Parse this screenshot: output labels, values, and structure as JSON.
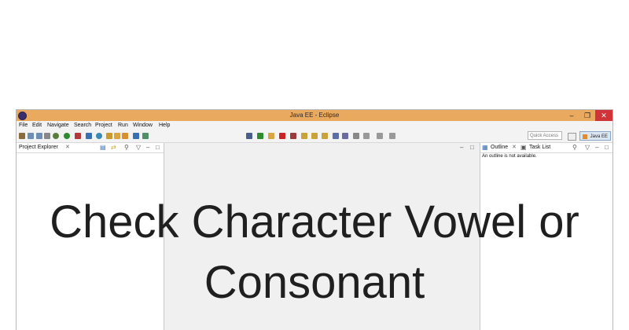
{
  "window": {
    "title": "Java EE - Eclipse",
    "min_glyph": "–",
    "max_glyph": "❐",
    "close_glyph": "✕"
  },
  "menu": [
    "File",
    "Edit",
    "Navigate",
    "Search",
    "Project",
    "Run",
    "Window",
    "Help"
  ],
  "toolbar": {
    "quick_access_placeholder": "Quick Access",
    "perspective_label": "Java EE",
    "icons": [
      {
        "name": "new-icon",
        "color": "#8a6d3b"
      },
      {
        "name": "save-icon",
        "color": "#6d8fb3"
      },
      {
        "name": "save-all-icon",
        "color": "#6d8fb3"
      },
      {
        "name": "print-icon",
        "color": "#888888"
      },
      {
        "name": "debug-icon",
        "color": "#5a7d3a"
      },
      {
        "name": "run-icon",
        "color": "#2e8b2e"
      },
      {
        "name": "external-tools-icon",
        "color": "#b33a3a"
      },
      {
        "name": "new-server-icon",
        "color": "#3a6fb3"
      },
      {
        "name": "globe-icon",
        "color": "#3a8bb3"
      },
      {
        "name": "open-type-icon",
        "color": "#c99a2e"
      },
      {
        "name": "open-folder-icon",
        "color": "#d9a441"
      },
      {
        "name": "search-tool-icon",
        "color": "#d98f2e"
      },
      {
        "name": "web-browser-icon",
        "color": "#3a6fb3"
      },
      {
        "name": "refresh-icon",
        "color": "#4f8f6a"
      },
      {
        "name": "pointer-icon",
        "color": "#4a5e8a"
      },
      {
        "name": "resume-icon",
        "color": "#2e8b2e"
      },
      {
        "name": "suspend-icon",
        "color": "#d9a441"
      },
      {
        "name": "terminate-icon",
        "color": "#cc2222"
      },
      {
        "name": "disconnect-icon",
        "color": "#9a3a3a"
      },
      {
        "name": "step-into-icon",
        "color": "#c9a23a"
      },
      {
        "name": "step-over-icon",
        "color": "#c9a23a"
      },
      {
        "name": "step-return-icon",
        "color": "#c9a23a"
      },
      {
        "name": "toggle-mark-icon",
        "color": "#5a6fa3"
      },
      {
        "name": "annotation-icon",
        "color": "#6a6aa3"
      },
      {
        "name": "pin-icon",
        "color": "#888888"
      },
      {
        "name": "next-annotation-icon",
        "color": "#999999"
      },
      {
        "name": "back-icon",
        "color": "#999999"
      },
      {
        "name": "forward-icon",
        "color": "#999999"
      }
    ]
  },
  "left_view": {
    "tab_label": "Project Explorer",
    "close_glyph": "✕"
  },
  "right_view": {
    "tabs": [
      {
        "label": "Outline"
      },
      {
        "label": "Task List"
      }
    ],
    "close_glyph": "✕",
    "message": "An outline is not available."
  },
  "headline": {
    "line1": "Check Character Vowel or",
    "line2": "Consonant"
  },
  "view_ctl": {
    "menu_glyph": "▽",
    "minimize_glyph": "–",
    "maximize_glyph": "□"
  }
}
